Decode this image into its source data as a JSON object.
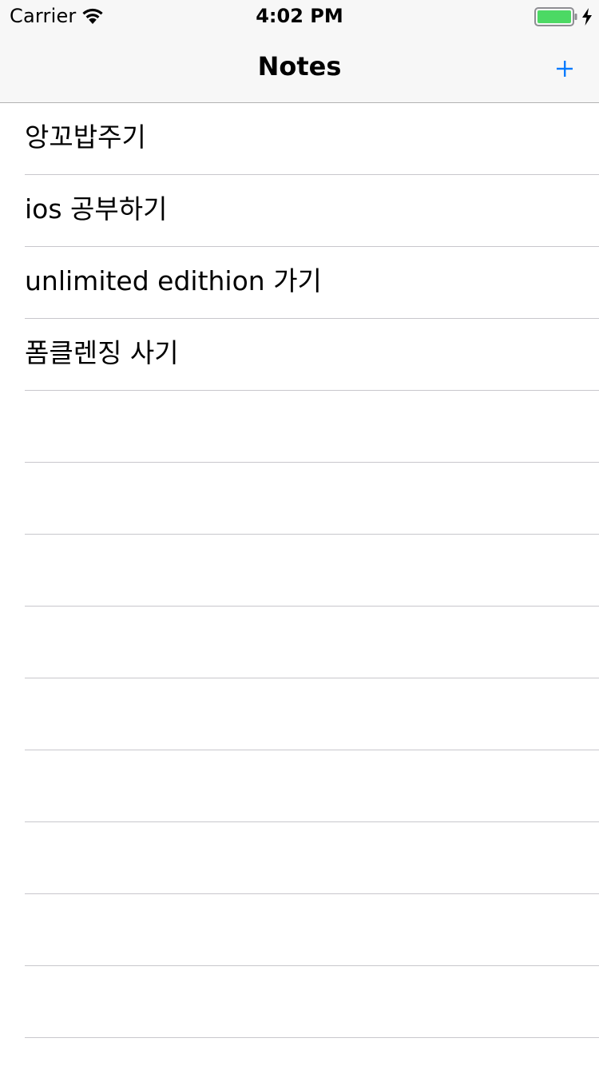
{
  "status_bar": {
    "carrier": "Carrier",
    "time": "4:02 PM",
    "wifi_icon": "wifi-icon",
    "battery_icon": "battery-icon",
    "charging_icon": "charging-bolt-icon",
    "battery_level": 1.0,
    "battery_color": "#4cd964"
  },
  "nav_bar": {
    "title": "Notes",
    "add_icon": "plus-icon",
    "accent_color": "#007aff"
  },
  "notes": [
    {
      "title": "앙꼬밥주기"
    },
    {
      "title": "ios 공부하기"
    },
    {
      "title": "unlimited edithion 가기"
    },
    {
      "title": "폼클렌징 사기"
    }
  ]
}
